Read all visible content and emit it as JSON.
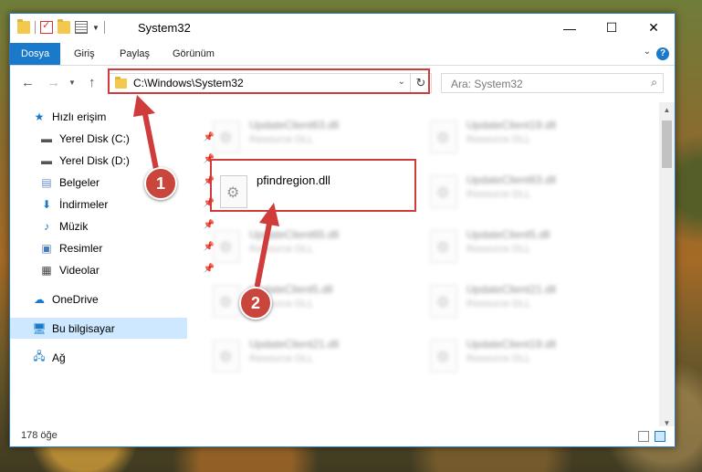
{
  "window": {
    "title": "System32"
  },
  "ribbon": {
    "tabs": [
      "Dosya",
      "Giriş",
      "Paylaş",
      "Görünüm"
    ]
  },
  "address": {
    "path": "C:\\Windows\\System32"
  },
  "search": {
    "placeholder": "Ara: System32"
  },
  "sidebar": {
    "items": [
      {
        "label": "Hızlı erişim"
      },
      {
        "label": "Yerel Disk (C:)"
      },
      {
        "label": "Yerel Disk (D:)"
      },
      {
        "label": "Belgeler"
      },
      {
        "label": "İndirmeler"
      },
      {
        "label": "Müzik"
      },
      {
        "label": "Resimler"
      },
      {
        "label": "Videolar"
      },
      {
        "label": "OneDrive"
      },
      {
        "label": "Bu bilgisayar"
      },
      {
        "label": "Ağ"
      }
    ]
  },
  "files": {
    "col1": [
      {
        "name": "UpdateClient63.dll",
        "type": "Resource DLL"
      },
      {
        "name": "pfindregion.dll",
        "type": ""
      },
      {
        "name": "UpdateClient65.dll",
        "type": "Resource DLL"
      },
      {
        "name": "UpdateClient5.dll",
        "type": "Resource DLL"
      },
      {
        "name": "UpdateClient21.dll",
        "type": "Resource DLL"
      }
    ],
    "col2": [
      {
        "name": "UpdateClient19.dll",
        "type": "Resource DLL"
      },
      {
        "name": "UpdateClient63.dll",
        "type": "Resource DLL"
      },
      {
        "name": "UpdateClient5.dll",
        "type": "Resource DLL"
      },
      {
        "name": "UpdateClient21.dll",
        "type": "Resource DLL"
      },
      {
        "name": "UpdateClient19.dll",
        "type": "Resource DLL"
      }
    ]
  },
  "status": {
    "count": "178 öğe"
  },
  "annotations": {
    "step1": "1",
    "step2": "2"
  },
  "colors": {
    "accent": "#1979ca",
    "highlight": "#d03b3b",
    "selected": "#cde8ff"
  }
}
